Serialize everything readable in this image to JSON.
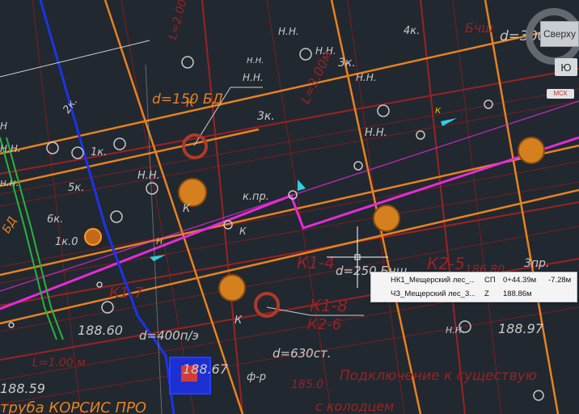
{
  "labels": {
    "t1": "Н.Н.",
    "t2": "БД",
    "t3": "d=150 БД",
    "t4": "К",
    "t5": "2к.",
    "t6": "1к.",
    "t7": "5к.",
    "t8": "Н.Н.",
    "t9": "6к.",
    "t10": "1к.0",
    "t11": "Н",
    "t12": "К",
    "t13": "3к.",
    "t14": "Н.Н.",
    "t15": "3к.",
    "t16": "4к.",
    "t17": "К",
    "t18": "к.пр.",
    "t19": "Н.Н.",
    "t20": "d=250 Бчш",
    "t21": "К1-4",
    "t22": "К2-5",
    "t23": "К1-8",
    "t24": "К2-6",
    "t25": "d=400п/э",
    "t26": "188.60",
    "t27": "188.67",
    "t28": "188.59",
    "t29": "d=630ст.",
    "t30": "185.0",
    "t31": "188.97",
    "t32": "3пр.",
    "t33": "186.80",
    "t34": "труба КОРСИС ПРО",
    "t35": "Подключение к существую",
    "t36": "с колодцем",
    "t37": "L=1.00 м",
    "t38": "d=300",
    "t39": "К1-7",
    "t40": "Н.Н.",
    "t41": "Н.Н.",
    "t42": "К",
    "t43": "Н.Н.",
    "t44": "Бчш",
    "t45": "К",
    "t46": "Н.Н.",
    "t47": "L=3.00м",
    "t48": "ф-р",
    "t49": "н.н.",
    "t50": "Н.Н.",
    "t51": "L=2.00м",
    "t52": "Н"
  },
  "viewcube": {
    "face_label": "Сверху",
    "compass_label": "Ю",
    "ucs_label": "МСК"
  },
  "tooltip": {
    "rows": [
      {
        "name": "НК1_Мещерский лес_...",
        "code": "СП",
        "value": "0+44.39м",
        "value2": "-7.28м"
      },
      {
        "name": "ЧЗ_Мещерский лес_3...",
        "code": "Z",
        "value": "188.86м",
        "value2": ""
      }
    ]
  },
  "colors": {
    "background": "#212830",
    "orange": "#e8821f",
    "dark_red": "#8a1d1d",
    "magenta": "#e52bd8",
    "blue": "#1d33e6",
    "green": "#27b53a",
    "white": "#d8d8d8"
  }
}
